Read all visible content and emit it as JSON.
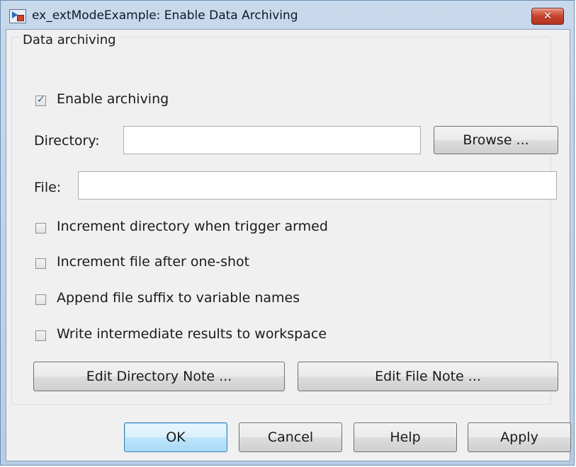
{
  "window": {
    "title": "ex_extModeExample: Enable Data Archiving",
    "close_label": "✕"
  },
  "group": {
    "legend": "Data archiving"
  },
  "enable_archiving": {
    "label": "Enable archiving",
    "checked": true
  },
  "directory": {
    "label": "Directory:",
    "value": "",
    "browse_label": "Browse ..."
  },
  "file": {
    "label": "File:",
    "value": ""
  },
  "options": [
    {
      "label": "Increment directory when trigger armed",
      "checked": false
    },
    {
      "label": "Increment file after one-shot",
      "checked": false
    },
    {
      "label": "Append file suffix to variable names",
      "checked": false
    },
    {
      "label": "Write intermediate results to workspace",
      "checked": false
    }
  ],
  "note_buttons": {
    "edit_directory_note": "Edit Directory Note ...",
    "edit_file_note": "Edit File Note ..."
  },
  "footer": {
    "ok": "OK",
    "cancel": "Cancel",
    "help": "Help",
    "apply": "Apply"
  }
}
